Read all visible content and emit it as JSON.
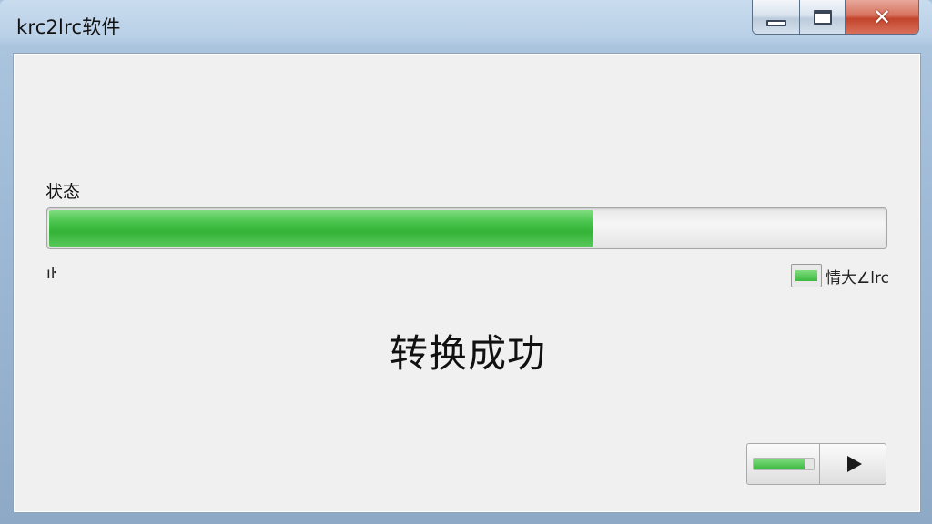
{
  "window": {
    "title": "krc2lrc软件"
  },
  "caption_buttons": {
    "minimize_icon": "minimize-icon",
    "maximize_icon": "maximize-icon",
    "close_icon": "close-icon",
    "close_glyph": "✕"
  },
  "status": {
    "label": "状态",
    "progress_fraction": 0.65,
    "left_mark": "ıŀ",
    "legend_text": "情大∠lrc",
    "colors": {
      "progress_green": "#3cb840",
      "track": "#e8e8e8"
    }
  },
  "result": {
    "message": "转换成功"
  },
  "controls": {
    "mini_progress_fraction": 0.85,
    "play_icon": "play-icon"
  }
}
